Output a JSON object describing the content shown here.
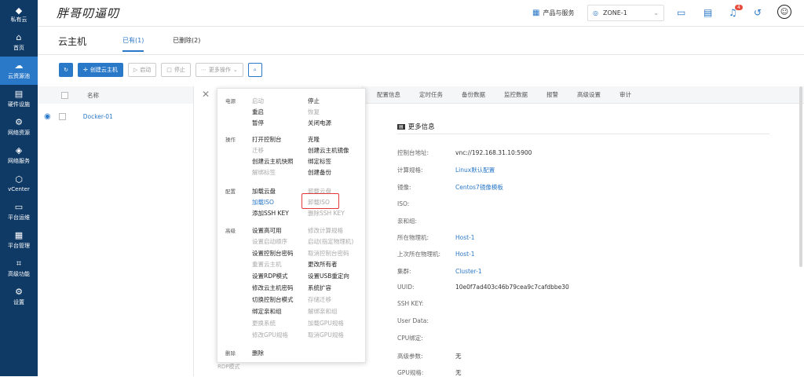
{
  "brand": {
    "label": "私有云"
  },
  "nav": [
    {
      "icon": "home-icon",
      "glyph": "⌂",
      "label": "首页"
    },
    {
      "icon": "cloud-resource-icon",
      "glyph": "☁",
      "label": "云资源池",
      "active": true
    },
    {
      "icon": "hardware-icon",
      "glyph": "▤",
      "label": "硬件设施"
    },
    {
      "icon": "network-resource-icon",
      "glyph": "⚙",
      "label": "网络资源"
    },
    {
      "icon": "network-service-icon",
      "glyph": "◈",
      "label": "网络服务"
    },
    {
      "icon": "vcenter-icon",
      "glyph": "⬡",
      "label": "vCenter"
    },
    {
      "icon": "platform-ops-icon",
      "glyph": "▭",
      "label": "平台运维"
    },
    {
      "icon": "platform-mgmt-icon",
      "glyph": "▦",
      "label": "平台管理"
    },
    {
      "icon": "advanced-icon",
      "glyph": "⌗",
      "label": "高级功能"
    },
    {
      "icon": "settings-icon",
      "glyph": "⚙",
      "label": "设置"
    }
  ],
  "header": {
    "logo": "胖哥叨逼叨",
    "products": "产品与服务",
    "zone": "ZONE-1",
    "notif_count": "4"
  },
  "page": {
    "title": "云主机",
    "tabs": [
      "已有(1)",
      "已删除(2)"
    ]
  },
  "toolbar": {
    "create": "创建云主机",
    "start": "启动",
    "stop": "停止",
    "more": "更多操作"
  },
  "list": {
    "col_name": "名称",
    "rows": [
      {
        "name": "Docker-01"
      }
    ]
  },
  "detail_tabs": [
    "配置信息",
    "定时任务",
    "备份数据",
    "监控数据",
    "报警",
    "高级设置",
    "审计"
  ],
  "more_info": {
    "title": "更多信息",
    "rows": [
      {
        "k": "控制台地址:",
        "v": "vnc://192.168.31.10:5900"
      },
      {
        "k": "计算规格:",
        "v": "Linux默认配置",
        "link": true
      },
      {
        "k": "镜像:",
        "v": "Centos7镜像模板",
        "link": true
      },
      {
        "k": "ISO:",
        "v": ""
      },
      {
        "k": "亲和组:",
        "v": ""
      },
      {
        "k": "所在物理机:",
        "v": "Host-1",
        "link": true
      },
      {
        "k": "上次所在物理机:",
        "v": "Host-1",
        "link": true
      },
      {
        "k": "集群:",
        "v": "Cluster-1",
        "link": true
      },
      {
        "k": "UUID:",
        "v": "10e0f7ad403c46b79cea9c7cafdbbe30"
      },
      {
        "k": "SSH KEY:",
        "v": ""
      },
      {
        "k": "User Data:",
        "v": ""
      },
      {
        "k": "CPU绑定:",
        "v": ""
      },
      {
        "k": "高级参数:",
        "v": "无"
      },
      {
        "k": "GPU规格:",
        "v": "无"
      }
    ]
  },
  "menu": {
    "groups": [
      "电源",
      "操作",
      "配置",
      "高级",
      "删除"
    ],
    "items": [
      [
        "启动",
        "停止"
      ],
      [
        "重启",
        "恢复"
      ],
      [
        "暂停",
        "关闭电源"
      ],
      [
        "打开控制台",
        "克隆"
      ],
      [
        "迁移",
        "创建云主机镜像"
      ],
      [
        "创建云主机快照",
        "绑定标签"
      ],
      [
        "解绑标签",
        "创建备份"
      ],
      [
        "加载云盘",
        "卸载云盘"
      ],
      [
        "加载ISO",
        "卸载ISO"
      ],
      [
        "添加SSH KEY",
        "删除SSH KEY"
      ],
      [
        "设置高可用",
        "修改计算规格"
      ],
      [
        "设置启动顺序",
        "启动(指定物理机)"
      ],
      [
        "设置控制台密码",
        "取消控制台密码"
      ],
      [
        "重置云主机",
        "更改所有者"
      ],
      [
        "设置RDP模式",
        "设置USB重定向"
      ],
      [
        "修改云主机密码",
        "系统扩容"
      ],
      [
        "切换控制台模式",
        "存储迁移"
      ],
      [
        "绑定亲和组",
        "解绑亲和组"
      ],
      [
        "更换系统",
        "加载GPU规格"
      ],
      [
        "修改GPU规格",
        "取消GPU规格"
      ],
      [
        "删除",
        ""
      ]
    ]
  },
  "under": {
    "rdp": "RDP模式"
  }
}
